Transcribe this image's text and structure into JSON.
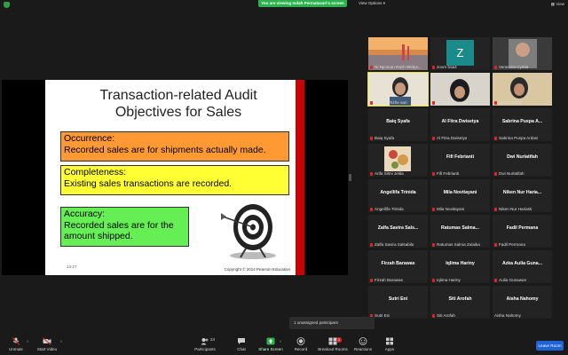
{
  "topbar": {
    "banner_text": "You are viewing Indah Permatasari's screen",
    "view_options": "View Options",
    "view_label": "View"
  },
  "slide": {
    "title_line1": "Transaction-related Audit",
    "title_line2": "Objectives for Sales",
    "boxes": [
      {
        "heading": "Occurrence:",
        "text": "Recorded sales are for shipments actually made.",
        "color": "#ff9933"
      },
      {
        "heading": "Completeness:",
        "text": "Existing sales transactions are recorded.",
        "color": "#ffff33"
      },
      {
        "heading": "Accuracy:",
        "text_line1": "Recorded sales are for the",
        "text_line2": "amount shipped.",
        "color": "#66ee55"
      }
    ],
    "slide_number": "14-27",
    "copyright": "Copyright © 2014 Pearson Education"
  },
  "gallery": {
    "tiles": [
      {
        "label": "Ni Nyoman Rach Widya...",
        "name": ""
      },
      {
        "label": "zoom baa4",
        "name": "",
        "avatar_letter": "Z"
      },
      {
        "label": "Venenzia Cyntia",
        "name": ""
      },
      {
        "label": "Alisyah Rizhe sari",
        "name": ""
      },
      {
        "label": "Indah Permatasari",
        "name": ""
      },
      {
        "label": "Dinda Safira",
        "name": ""
      },
      {
        "label": "Baiq Syafa",
        "name": "Baiq Syafa"
      },
      {
        "label": "Al Fitra Dwisetya",
        "name": "Al Fitra Dwisetya"
      },
      {
        "label": "Sabrina Puspa Ardani",
        "name": "Sabrina Puspa A..."
      },
      {
        "label": "Arifa Silmi Jelita",
        "name": ""
      },
      {
        "label": "Fifi Febrianti",
        "name": "Fifi Febrianti"
      },
      {
        "label": "Dwi Nurlatifah",
        "name": "Dwi Nurlatifah"
      },
      {
        "label": "Angellifa Trinida",
        "name": "Angellifa Trinida"
      },
      {
        "label": "Mila Novitayani",
        "name": "Mila Novitayani"
      },
      {
        "label": "Niken Nur Hariasti",
        "name": "Niken Nur Haria..."
      },
      {
        "label": "Zalfa Savira Salsabila",
        "name": "Zalfa Savira Sals..."
      },
      {
        "label": "Ratumas Salma Zulaika",
        "name": "Ratumas Salma..."
      },
      {
        "label": "Fadil Permana",
        "name": "Fadil Permana"
      },
      {
        "label": "Firzah Barawas",
        "name": "Firzah Barawas"
      },
      {
        "label": "Iqlima Hariny",
        "name": "Iqlima Hariny"
      },
      {
        "label": "Aulia Gunawan",
        "name": "Azka Aulia Guna..."
      },
      {
        "label": "Sutri Eni",
        "name": "Sutri Eni"
      },
      {
        "label": "Siti Arofah",
        "name": "Siti Arofah"
      },
      {
        "label": "Aisha Nahomy",
        "name": "Aisha Nahomy"
      }
    ]
  },
  "popup": {
    "unassigned": "1 unassigned participant"
  },
  "toolbar": {
    "unmute": "Unmute",
    "start_video": "Start Video",
    "participants": "Participants",
    "participants_count": "24",
    "chat": "Chat",
    "share_screen": "Share Screen",
    "record": "Record",
    "breakout": "Breakout Rooms",
    "breakout_badge": "1",
    "reactions": "Reactions",
    "apps": "Apps",
    "leave": "Leave Room"
  },
  "colors": {
    "accent_green": "#2bb24c",
    "leave_blue": "#1f63d6",
    "active_speaker": "#e7e03a",
    "slide_red": "#cc0000"
  }
}
